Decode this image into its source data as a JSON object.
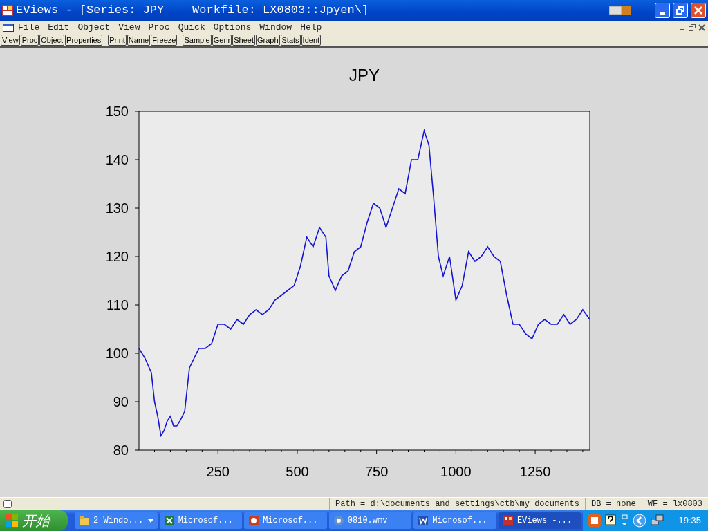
{
  "window": {
    "title": "EViews - [Series: JPY    Workfile: LX0803::Jpyen\\]"
  },
  "menu": [
    {
      "label": "File"
    },
    {
      "label": "Edit"
    },
    {
      "label": "Object"
    },
    {
      "label": "View"
    },
    {
      "label": "Proc"
    },
    {
      "label": "Quick"
    },
    {
      "label": "Options"
    },
    {
      "label": "Window"
    },
    {
      "label": "Help"
    }
  ],
  "toolbar_groups": [
    [
      "View",
      "Proc",
      "Object",
      "Properties"
    ],
    [
      "Print",
      "Name",
      "Freeze"
    ],
    [
      "Sample",
      "Genr",
      "Sheet",
      "Graph",
      "Stats",
      "Ident"
    ]
  ],
  "chart": {
    "chart_data": {
      "type": "line",
      "title": "JPY",
      "x": [
        1,
        20,
        40,
        50,
        60,
        70,
        80,
        90,
        100,
        110,
        120,
        130,
        145,
        160,
        175,
        190,
        210,
        230,
        250,
        270,
        290,
        310,
        330,
        350,
        370,
        390,
        410,
        430,
        450,
        470,
        490,
        510,
        530,
        550,
        570,
        590,
        600,
        620,
        640,
        660,
        680,
        700,
        720,
        740,
        760,
        780,
        800,
        820,
        840,
        860,
        880,
        900,
        915,
        930,
        945,
        960,
        980,
        1000,
        1020,
        1040,
        1060,
        1080,
        1100,
        1120,
        1140,
        1160,
        1180,
        1200,
        1220,
        1240,
        1260,
        1280,
        1300,
        1320,
        1340,
        1360,
        1380,
        1400,
        1422
      ],
      "series": [
        {
          "color": "#1414d2",
          "values": [
            101,
            99,
            96,
            90,
            87,
            83,
            84,
            86,
            87,
            85,
            85,
            86,
            88,
            97,
            99,
            101,
            101,
            102,
            106,
            106,
            105,
            107,
            106,
            108,
            109,
            108,
            109,
            111,
            112,
            113,
            114,
            118,
            124,
            122,
            126,
            124,
            116,
            113,
            116,
            117,
            121,
            122,
            127,
            131,
            130,
            126,
            130,
            134,
            133,
            140,
            140,
            146,
            143,
            132,
            120,
            116,
            120,
            111,
            114,
            121,
            119,
            120,
            122,
            120,
            119,
            112,
            106,
            106,
            104,
            103,
            106,
            107,
            106,
            106,
            108,
            106,
            107,
            109,
            107
          ]
        }
      ],
      "xlim": [
        1,
        1422
      ],
      "ylim": [
        80,
        150
      ],
      "xticks": [
        250,
        500,
        750,
        1000,
        1250
      ],
      "yticks": [
        80,
        90,
        100,
        110,
        120,
        130,
        140,
        150
      ]
    }
  },
  "status_bar": {
    "path": "Path = d:\\documents and settings\\ctb\\my documents",
    "db": "DB = none",
    "wf": "WF = lx0803"
  },
  "taskbar": {
    "start": "开始",
    "tasks": [
      {
        "label": "2 Windo...",
        "kind": "folder",
        "selected": false,
        "grouped": true
      },
      {
        "label": "Microsof...",
        "kind": "excel",
        "selected": false,
        "grouped": false
      },
      {
        "label": "Microsof...",
        "kind": "powerpoint",
        "selected": false,
        "grouped": false
      },
      {
        "label": "0810.wmv",
        "kind": "media",
        "selected": false,
        "grouped": false
      },
      {
        "label": "Microsof...",
        "kind": "word",
        "selected": false,
        "grouped": false
      },
      {
        "label": "EViews -...",
        "kind": "eviews",
        "selected": true,
        "grouped": false
      }
    ],
    "clock": "19:35"
  }
}
